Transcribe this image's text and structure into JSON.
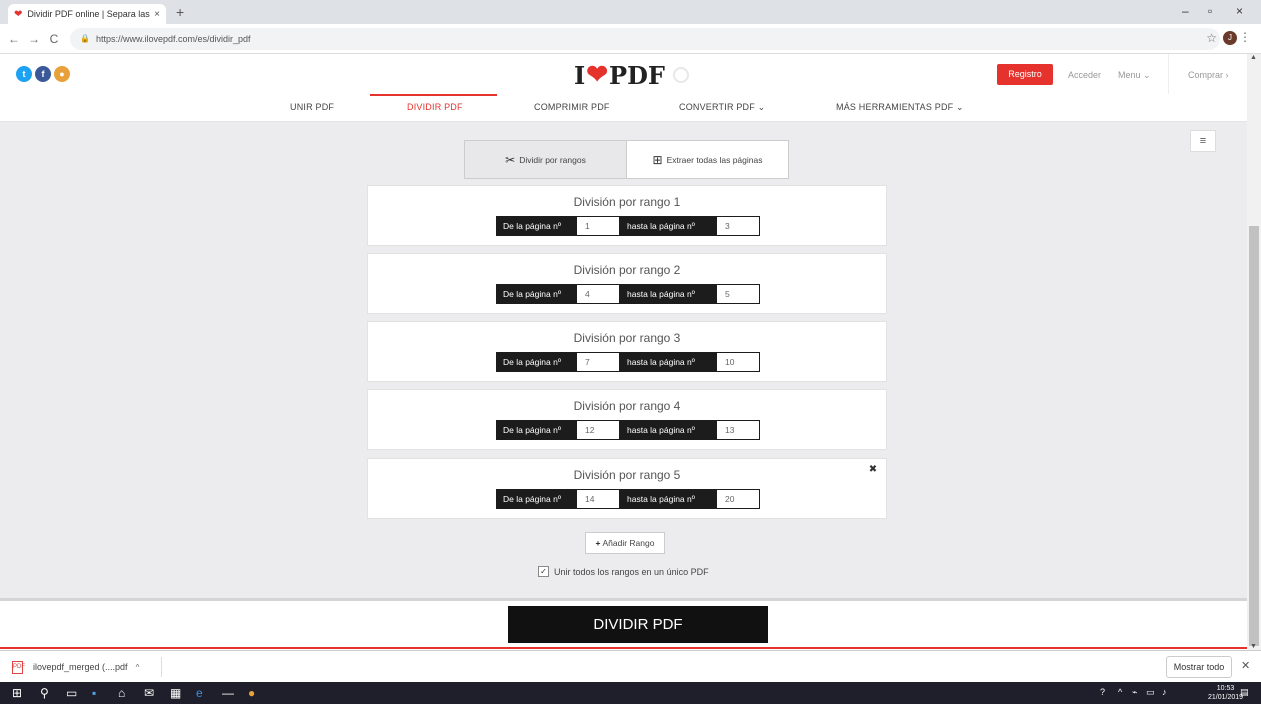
{
  "browser": {
    "tab_title": "Dividir PDF online | Separa las pá",
    "tab_close": "×",
    "new_tab": "+",
    "url": "https://www.ilovepdf.com/es/dividir_pdf",
    "window_controls": [
      "–",
      "▫",
      "×"
    ]
  },
  "header": {
    "logo_left": "I",
    "logo_right": "PDF",
    "registro": "Registro",
    "acceder": "Acceder",
    "menu": "Menu ⌄",
    "comprar": "Comprar ›"
  },
  "nav": {
    "items": [
      "UNIR PDF",
      "DIVIDIR PDF",
      "COMPRIMIR PDF",
      "CONVERTIR PDF ⌄",
      "MÁS HERRAMIENTAS PDF ⌄"
    ],
    "active": "DIVIDIR PDF"
  },
  "modes": {
    "split_ranges": "Dividir por rangos",
    "extract_all": "Extraer todas las páginas"
  },
  "ranges": [
    {
      "title": "División por rango 1",
      "from_label": "De la página nº",
      "from": "1",
      "to_label": "hasta la página nº",
      "to": "3"
    },
    {
      "title": "División por rango 2",
      "from_label": "De la página nº",
      "from": "4",
      "to_label": "hasta la página nº",
      "to": "5"
    },
    {
      "title": "División por rango 3",
      "from_label": "De la página nº",
      "from": "7",
      "to_label": "hasta la página nº",
      "to": "10"
    },
    {
      "title": "División por rango 4",
      "from_label": "De la página nº",
      "from": "12",
      "to_label": "hasta la página nº",
      "to": "13"
    },
    {
      "title": "División por rango 5",
      "from_label": "De la página nº",
      "from": "14",
      "to_label": "hasta la página nº",
      "to": "20"
    }
  ],
  "add_range": "Añadir Rango",
  "merge_label": "Unir todos los rangos en un único PDF",
  "merge_checked": true,
  "submit": "DIVIDIR PDF",
  "downloads": {
    "file": "ilovepdf_merged (....pdf",
    "show_all": "Mostrar todo"
  },
  "taskbar": {
    "time": "10:53",
    "date": "21/01/2019"
  },
  "colors": {
    "accent": "#e5322d",
    "dark": "#1c1c1c"
  }
}
